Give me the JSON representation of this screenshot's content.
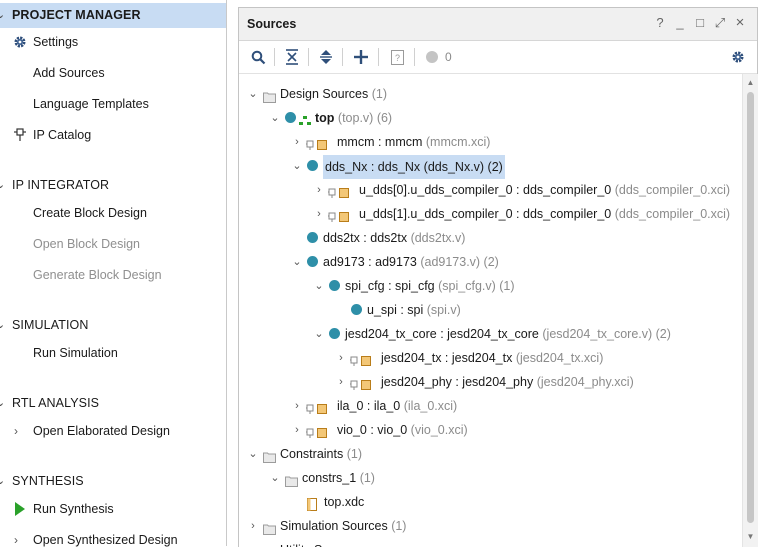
{
  "nav": {
    "sections": [
      {
        "label": "PROJECT MANAGER",
        "items": [
          {
            "label": "Settings",
            "icon": "gear-icon"
          },
          {
            "label": "Add Sources"
          },
          {
            "label": "Language Templates"
          },
          {
            "label": "IP Catalog",
            "icon": "plug-icon"
          }
        ]
      },
      {
        "label": "IP INTEGRATOR",
        "items": [
          {
            "label": "Create Block Design"
          },
          {
            "label": "Open Block Design",
            "disabled": true
          },
          {
            "label": "Generate Block Design",
            "disabled": true
          }
        ]
      },
      {
        "label": "SIMULATION",
        "items": [
          {
            "label": "Run Simulation"
          }
        ]
      },
      {
        "label": "RTL ANALYSIS",
        "items": [
          {
            "label": "Open Elaborated Design"
          }
        ]
      },
      {
        "label": "SYNTHESIS",
        "items": [
          {
            "label": "Run Synthesis",
            "icon": "run-play-icon"
          },
          {
            "label": "Open Synthesized Design"
          }
        ]
      }
    ]
  },
  "sources": {
    "title": "Sources",
    "window_controls": [
      "?",
      "_",
      "□",
      "⤢",
      "×"
    ],
    "toolbar": {
      "message_count": "0"
    },
    "tree": {
      "design_sources": {
        "label": "Design Sources",
        "count": "(1)"
      },
      "top": {
        "label": "top",
        "file": "(top.v) (6)"
      },
      "mmcm": {
        "label": "mmcm : mmcm",
        "file": "(mmcm.xci)"
      },
      "dds_nx": {
        "label": "dds_Nx : dds_Nx (dds_Nx.v) (2)"
      },
      "u_dds0": {
        "label": "u_dds[0].u_dds_compiler_0 : dds_compiler_0",
        "file": "(dds_compiler_0.xci)"
      },
      "u_dds1": {
        "label": "u_dds[1].u_dds_compiler_0 : dds_compiler_0",
        "file": "(dds_compiler_0.xci)"
      },
      "dds2tx": {
        "label": "dds2tx : dds2tx",
        "file": "(dds2tx.v)"
      },
      "ad9173": {
        "label": "ad9173 : ad9173",
        "file": "(ad9173.v) (2)"
      },
      "spi_cfg": {
        "label": "spi_cfg : spi_cfg",
        "file": "(spi_cfg.v) (1)"
      },
      "u_spi": {
        "label": "u_spi : spi",
        "file": "(spi.v)"
      },
      "jesd_core": {
        "label": "jesd204_tx_core : jesd204_tx_core",
        "file": "(jesd204_tx_core.v) (2)"
      },
      "jesd_tx": {
        "label": "jesd204_tx : jesd204_tx",
        "file": "(jesd204_tx.xci)"
      },
      "jesd_phy": {
        "label": "jesd204_phy : jesd204_phy",
        "file": "(jesd204_phy.xci)"
      },
      "ila_0": {
        "label": "ila_0 : ila_0",
        "file": "(ila_0.xci)"
      },
      "vio_0": {
        "label": "vio_0 : vio_0",
        "file": "(vio_0.xci)"
      },
      "constraints": {
        "label": "Constraints",
        "count": "(1)"
      },
      "constrs_1": {
        "label": "constrs_1",
        "count": "(1)"
      },
      "top_xdc": {
        "label": "top.xdc"
      },
      "sim_sources": {
        "label": "Simulation Sources",
        "count": "(1)"
      },
      "utility_sources": {
        "label": "Utility Sources"
      }
    }
  },
  "colors": {
    "accent": "#2e8fa8",
    "selection": "#c8dcf3",
    "run_green": "#2aa12a"
  }
}
